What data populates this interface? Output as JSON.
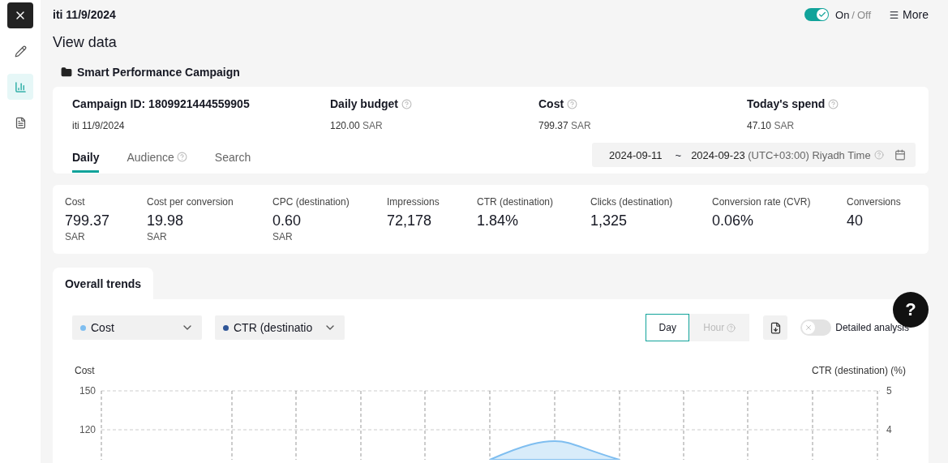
{
  "sidebar": {
    "items": [
      {
        "kind": "edit",
        "selected": false
      },
      {
        "kind": "chart",
        "selected": true
      },
      {
        "kind": "document",
        "selected": false
      }
    ]
  },
  "header": {
    "title": "iti 11/9/2024",
    "switch": {
      "on": true,
      "on_label": "On",
      "separator": "/",
      "off_label": "Off"
    },
    "more": "More"
  },
  "page_title": "View data",
  "campaign": {
    "name": "Smart Performance Campaign",
    "summary": [
      {
        "label": "Campaign ID: 1809921444559905",
        "help": false,
        "value": "iti 11/9/2024"
      },
      {
        "label": "Daily budget",
        "help": true,
        "value": "120.00",
        "unit": "SAR"
      },
      {
        "label": "Cost",
        "help": true,
        "value": "799.37",
        "unit": "SAR"
      },
      {
        "label": "Today's spend",
        "help": true,
        "value": "47.10",
        "unit": "SAR"
      }
    ],
    "tabs": [
      {
        "label": "Daily",
        "help": false,
        "selected": true
      },
      {
        "label": "Audience",
        "help": true,
        "selected": false
      },
      {
        "label": "Search",
        "help": false,
        "selected": false
      }
    ],
    "date_range": {
      "start": "2024-09-11",
      "separator": "~",
      "end": "2024-09-23",
      "timezone": "(UTC+03:00) Riyadh Time"
    }
  },
  "metrics": [
    {
      "label": "Cost",
      "value": "799.37",
      "unit": "SAR"
    },
    {
      "label": "Cost per conversion",
      "value": "19.98",
      "unit": "SAR"
    },
    {
      "label": "CPC (destination)",
      "value": "0.60",
      "unit": "SAR"
    },
    {
      "label": "Impressions",
      "value": "72,178"
    },
    {
      "label": "CTR (destination)",
      "value": "1.84%"
    },
    {
      "label": "Clicks (destination)",
      "value": "1,325"
    },
    {
      "label": "Conversion rate (CVR)",
      "value": "0.06%"
    },
    {
      "label": "Conversions",
      "value": "40"
    }
  ],
  "trends": {
    "tab": "Overall trends",
    "selectors": [
      {
        "label": "Cost",
        "color": "#7fbef0"
      },
      {
        "label": "CTR (destinatio",
        "color": "#2f5597"
      }
    ],
    "granularity": [
      {
        "label": "Day",
        "selected": true,
        "disabled": false,
        "help": false
      },
      {
        "label": "Hour",
        "selected": false,
        "disabled": true,
        "help": true
      }
    ],
    "detailed_analysis": {
      "label": "Detailed analysis",
      "on": false
    },
    "chart": {
      "left_title": "Cost",
      "right_title": "CTR (destination) (%)",
      "left_ticks": [
        "150",
        "120"
      ],
      "right_ticks": [
        "5",
        "4"
      ]
    }
  },
  "help_button": "?"
}
